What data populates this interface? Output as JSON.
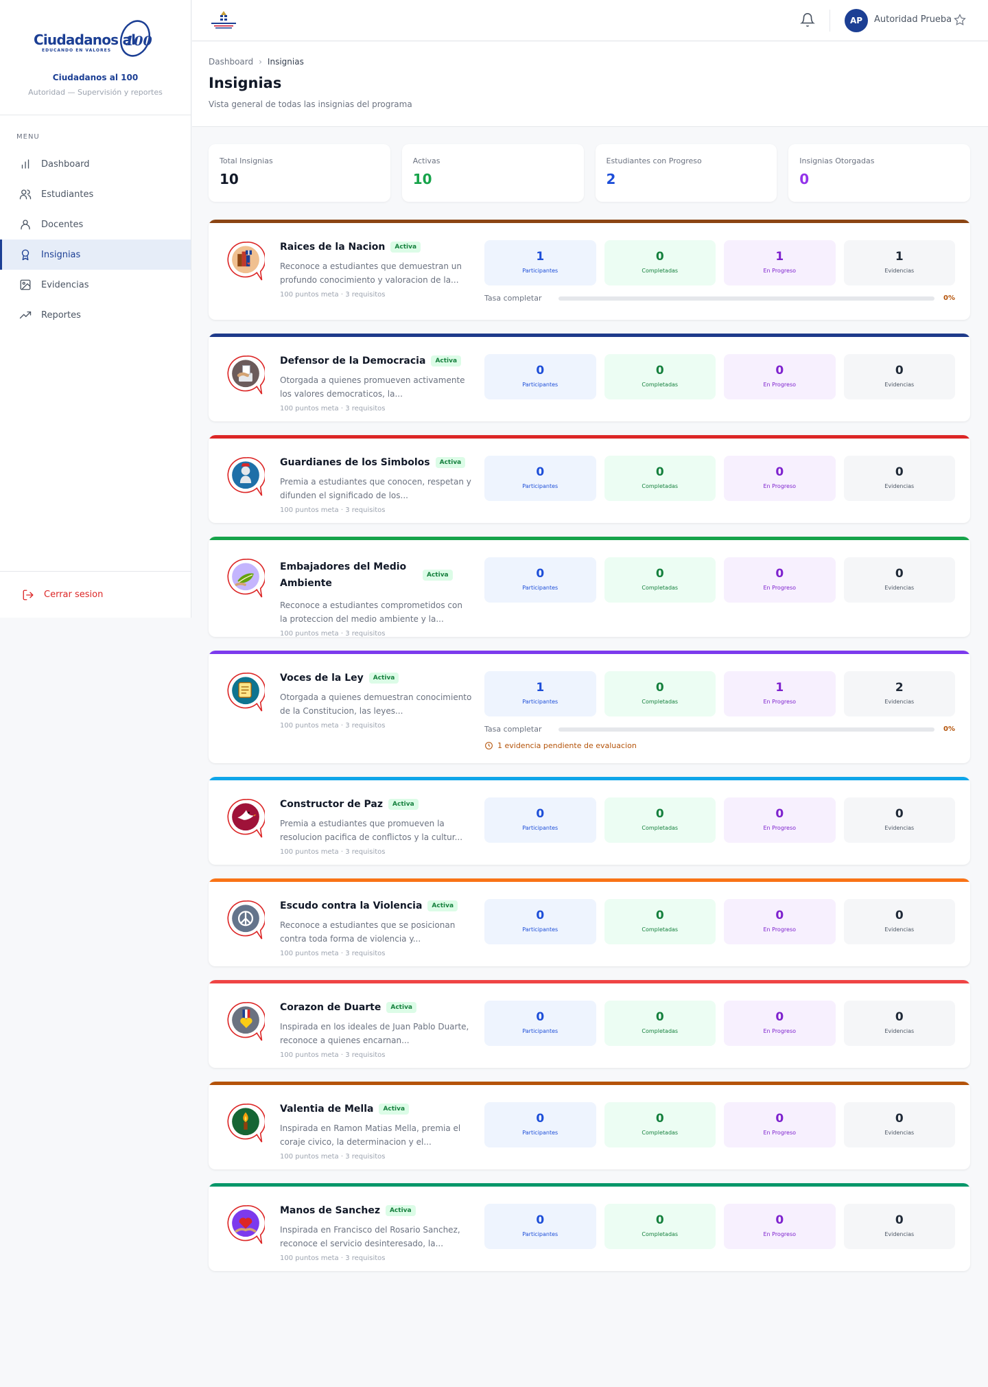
{
  "brand": {
    "logo_text": "Ciudadanos al",
    "logo_number": "100",
    "logo_tagline": "EDUCANDO EN VALORES",
    "name": "Ciudadanos al 100",
    "role": "Autoridad — Supervisión y reportes"
  },
  "sidebar": {
    "menu_heading": "MENU",
    "items": [
      {
        "label": "Dashboard",
        "icon": "bar-chart-icon"
      },
      {
        "label": "Estudiantes",
        "icon": "users-icon"
      },
      {
        "label": "Docentes",
        "icon": "user-icon"
      },
      {
        "label": "Insignias",
        "icon": "award-icon",
        "active": true
      },
      {
        "label": "Evidencias",
        "icon": "image-icon"
      },
      {
        "label": "Reportes",
        "icon": "trending-up-icon"
      }
    ],
    "logout_label": "Cerrar sesion"
  },
  "topbar": {
    "avatar_initials": "AP",
    "user_name": "Autoridad Prueba"
  },
  "header": {
    "breadcrumb": [
      "Dashboard",
      "Insignias"
    ],
    "title": "Insignias",
    "subtitle": "Vista general de todas las insignias del programa"
  },
  "stats": [
    {
      "label": "Total Insignias",
      "value": "10",
      "color": "#111827"
    },
    {
      "label": "Activas",
      "value": "10",
      "color": "#16a34a"
    },
    {
      "label": "Estudiantes con Progreso",
      "value": "2",
      "color": "#1d4ed8"
    },
    {
      "label": "Insignias Otorgadas",
      "value": "0",
      "color": "#9333ea"
    }
  ],
  "metric_labels": {
    "participants": "Participantes",
    "completed": "Completadas",
    "in_progress": "En Progreso",
    "evidences": "Evidencias"
  },
  "progress_label": "Tasa completar",
  "badges": [
    {
      "title": "Raices de la Nacion",
      "status": "Activa",
      "description": "Reconoce a estudiantes que demuestran un profundo conocimiento y valoracion de la...",
      "meta": "100 puntos meta · 3 requisitos",
      "color": "#8b4513",
      "icon": "books-flag-icon",
      "participants": "1",
      "completed": "0",
      "in_progress": "1",
      "evidences": "1",
      "completion_rate": "0%"
    },
    {
      "title": "Defensor de la Democracia",
      "status": "Activa",
      "description": "Otorgada a quienes promueven activamente los valores democraticos, la...",
      "meta": "100 puntos meta · 3 requisitos",
      "color": "#1e3a8a",
      "icon": "ballot-hand-icon",
      "participants": "0",
      "completed": "0",
      "in_progress": "0",
      "evidences": "0"
    },
    {
      "title": "Guardianes de los Simbolos",
      "status": "Activa",
      "description": "Premia a estudiantes que conocen, respetan y difunden el significado de los...",
      "meta": "100 puntos meta · 3 requisitos",
      "color": "#dc2626",
      "icon": "shield-bust-icon",
      "participants": "0",
      "completed": "0",
      "in_progress": "0",
      "evidences": "0"
    },
    {
      "title": "Embajadores del Medio Ambiente",
      "status": "Activa",
      "description": "Reconoce a estudiantes comprometidos con la proteccion del medio ambiente y la...",
      "meta": "100 puntos meta · 3 requisitos",
      "color": "#16a34a",
      "icon": "leaf-hands-icon",
      "participants": "0",
      "completed": "0",
      "in_progress": "0",
      "evidences": "0"
    },
    {
      "title": "Voces de la Ley",
      "status": "Activa",
      "description": "Otorgada a quienes demuestran conocimiento de la Constitucion, las leyes...",
      "meta": "100 puntos meta · 3 requisitos",
      "color": "#7c3aed",
      "icon": "law-scroll-icon",
      "participants": "1",
      "completed": "0",
      "in_progress": "1",
      "evidences": "2",
      "completion_rate": "0%",
      "pending_note": "1 evidencia pendiente de evaluacion"
    },
    {
      "title": "Constructor de Paz",
      "status": "Activa",
      "description": "Premia a estudiantes que promueven la resolucion pacifica de conflictos y la cultur...",
      "meta": "100 puntos meta · 3 requisitos",
      "color": "#0ea5e9",
      "icon": "dove-icon",
      "participants": "0",
      "completed": "0",
      "in_progress": "0",
      "evidences": "0"
    },
    {
      "title": "Escudo contra la Violencia",
      "status": "Activa",
      "description": "Reconoce a estudiantes que se posicionan contra toda forma de violencia y...",
      "meta": "100 puntos meta · 3 requisitos",
      "color": "#f97316",
      "icon": "peace-sign-icon",
      "participants": "0",
      "completed": "0",
      "in_progress": "0",
      "evidences": "0"
    },
    {
      "title": "Corazon de Duarte",
      "status": "Activa",
      "description": "Inspirada en los ideales de Juan Pablo Duarte, reconoce a quienes encarnan...",
      "meta": "100 puntos meta · 3 requisitos",
      "color": "#ef4444",
      "icon": "medal-heart-icon",
      "participants": "0",
      "completed": "0",
      "in_progress": "0",
      "evidences": "0"
    },
    {
      "title": "Valentia de Mella",
      "status": "Activa",
      "description": "Inspirada en Ramon Matias Mella, premia el coraje civico, la determinacion y el...",
      "meta": "100 puntos meta · 3 requisitos",
      "color": "#b45309",
      "icon": "torch-icon",
      "participants": "0",
      "completed": "0",
      "in_progress": "0",
      "evidences": "0"
    },
    {
      "title": "Manos de Sanchez",
      "status": "Activa",
      "description": "Inspirada en Francisco del Rosario Sanchez, reconoce el servicio desinteresado, la...",
      "meta": "100 puntos meta · 3 requisitos",
      "color": "#059669",
      "icon": "heart-hands-icon",
      "participants": "0",
      "completed": "0",
      "in_progress": "0",
      "evidences": "0"
    }
  ]
}
